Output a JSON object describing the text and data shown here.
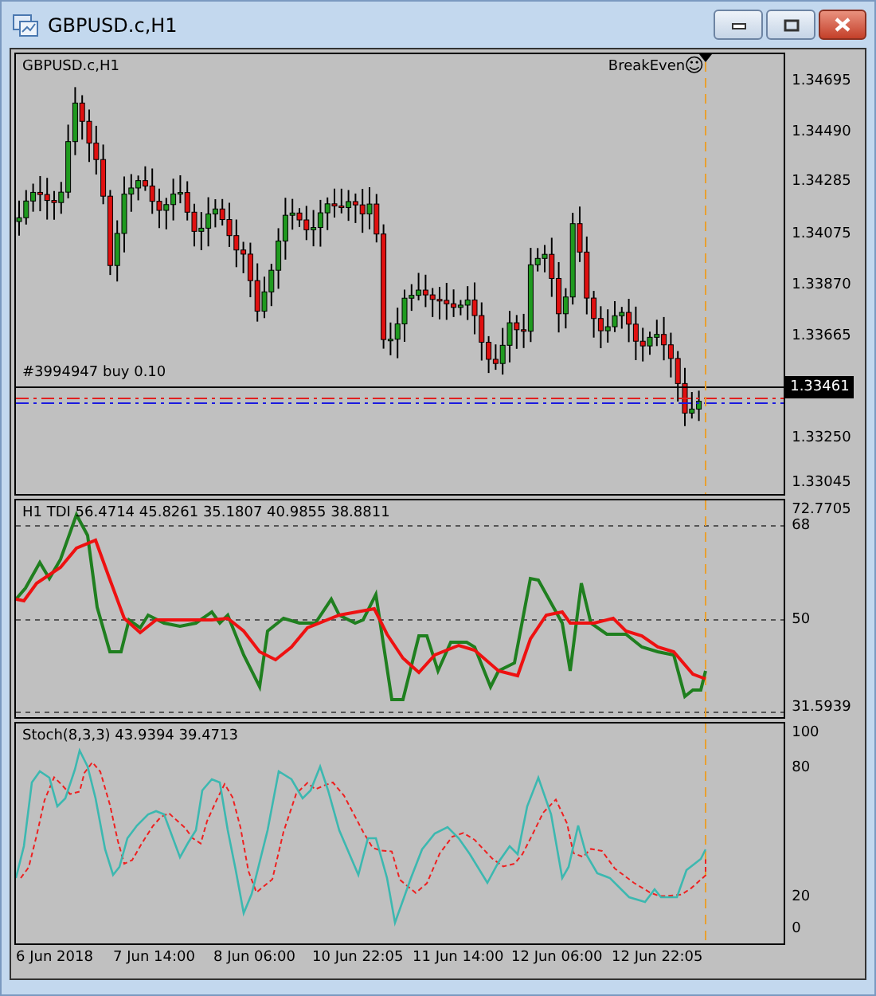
{
  "window": {
    "title": "GBPUSD.c,H1"
  },
  "chart": {
    "symbol_label": "GBPUSD.c,H1",
    "expert": "BreakEven",
    "expert_icon": "☺",
    "order_label": "#3994947 buy 0.10",
    "current_price": "1.33461",
    "price_ticks": [
      "1.34695",
      "1.34490",
      "1.34285",
      "1.34075",
      "1.33870",
      "1.33665",
      "1.33250",
      "1.33045"
    ]
  },
  "tdi": {
    "label": "H1 TDI 56.4714 45.8261 35.1807 40.9855 38.8811",
    "ticks": [
      "72.7705",
      "68",
      "50",
      "31.5939"
    ]
  },
  "stoch": {
    "label": "Stoch(8,3,3) 43.9394 39.4713",
    "ticks": [
      "100",
      "80",
      "20",
      "0"
    ]
  },
  "time_axis": [
    "6 Jun 2018",
    "7 Jun 14:00",
    "8 Jun 06:00",
    "10 Jun 22:05",
    "11 Jun 14:00",
    "12 Jun 06:00",
    "12 Jun 22:05"
  ]
}
